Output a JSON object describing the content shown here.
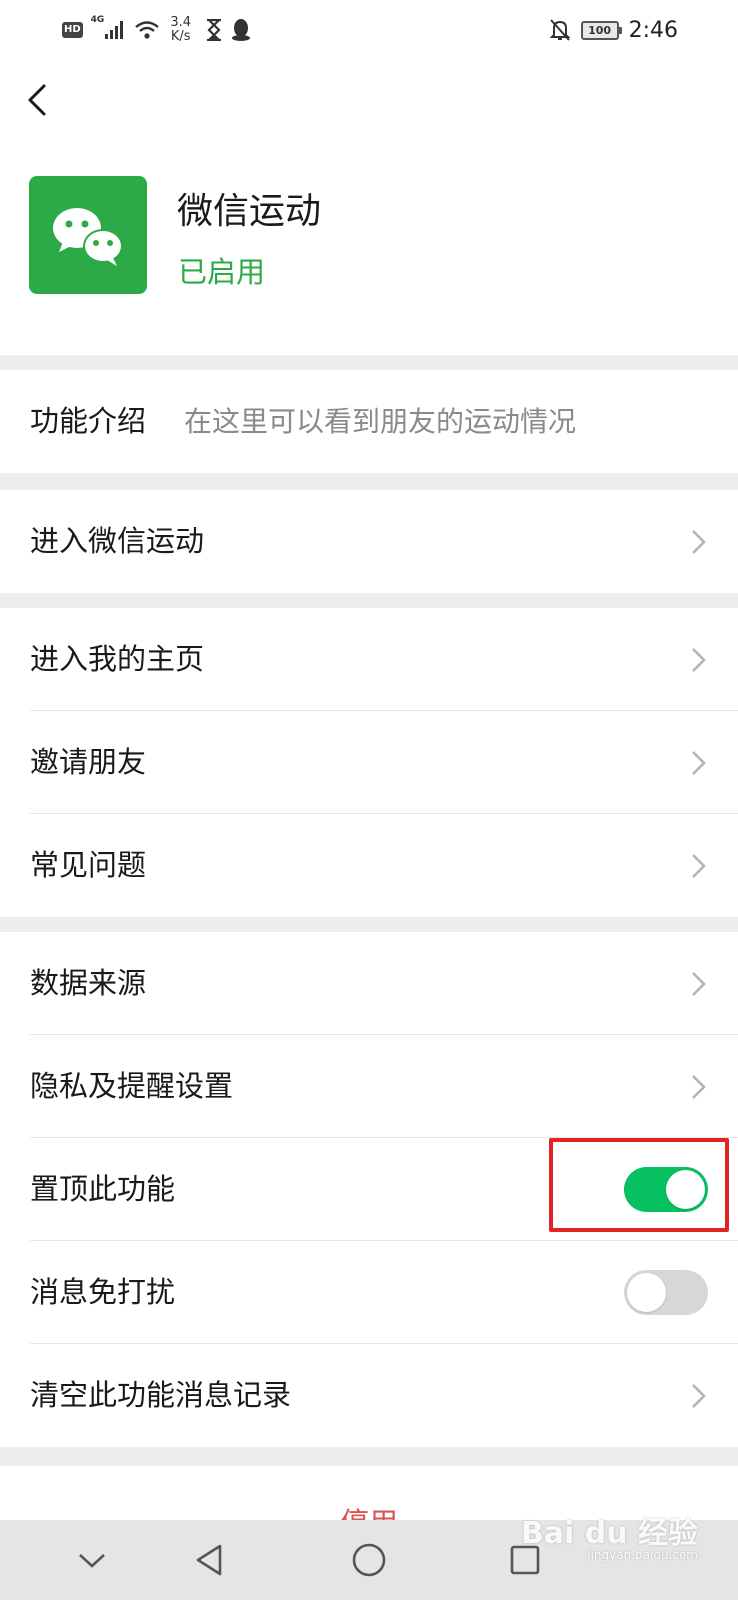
{
  "status_bar": {
    "hd": "HD",
    "network": "4G",
    "speed_value": "3.4",
    "speed_unit": "K/s",
    "battery": "100",
    "time": "2:46"
  },
  "header": {
    "app_name": "微信运动",
    "app_status": "已启用"
  },
  "intro": {
    "label": "功能介绍",
    "value": "在这里可以看到朋友的运动情况"
  },
  "sections": {
    "enter": "进入微信运动",
    "group2": [
      "进入我的主页",
      "邀请朋友",
      "常见问题"
    ],
    "data_source": "数据来源",
    "privacy": "隐私及提醒设置",
    "pin_label": "置顶此功能",
    "pin_on": true,
    "mute_label": "消息免打扰",
    "mute_on": false,
    "clear": "清空此功能消息记录"
  },
  "bottom": {
    "disable_label": "停用"
  },
  "watermark": {
    "brand": "Bai du 经验",
    "url": "jingyan.baidu.com"
  },
  "colors": {
    "accent_green": "#07c160",
    "icon_green": "#2daa48",
    "highlight_red": "#e02424"
  }
}
